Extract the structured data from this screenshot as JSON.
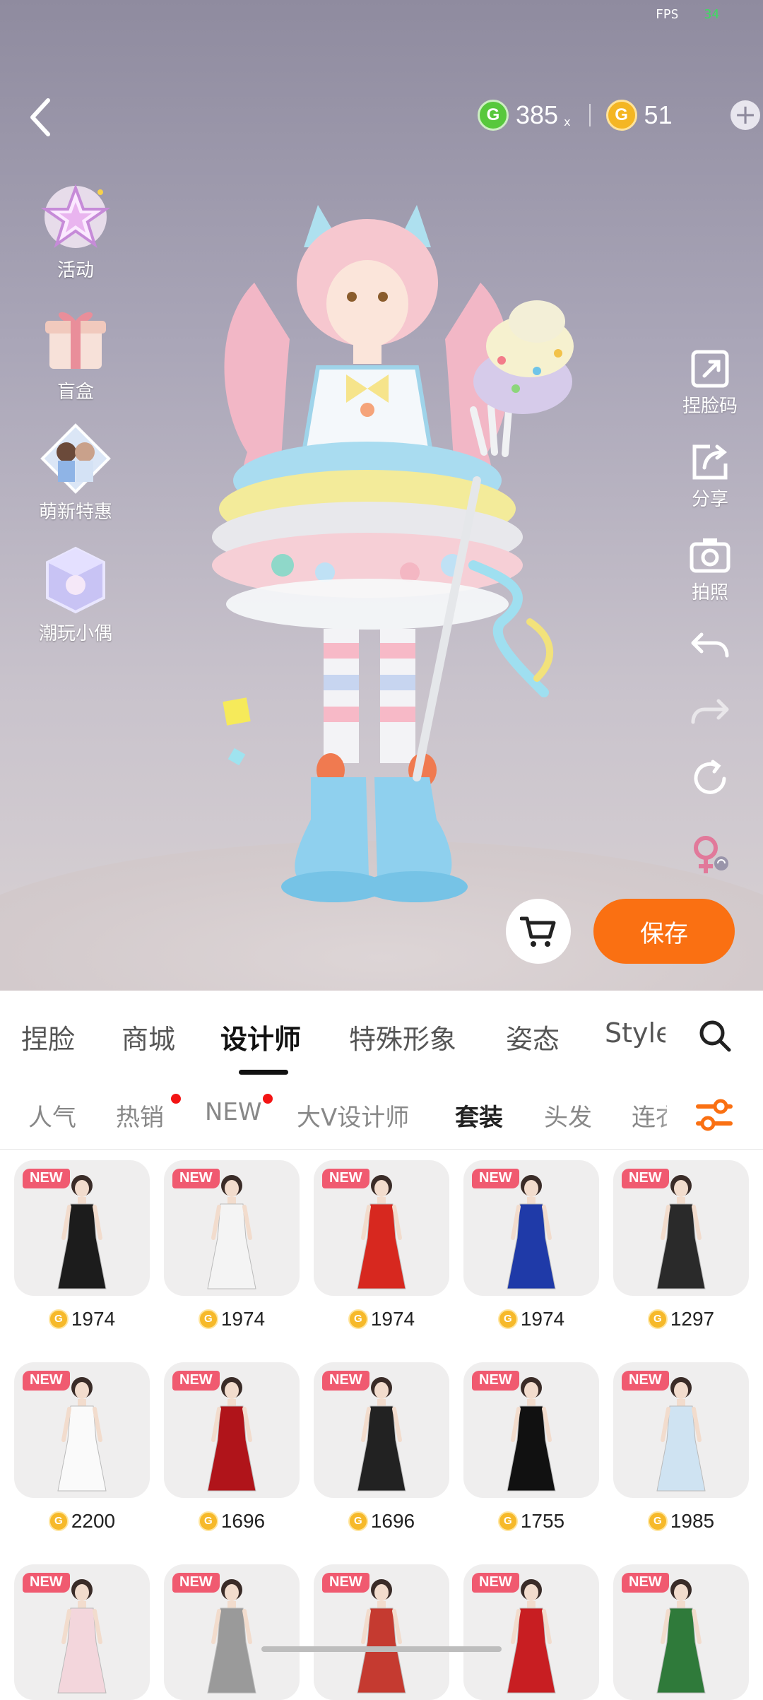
{
  "status": {
    "fps_label": "FPS",
    "fps_value": "34"
  },
  "currency": {
    "green_icon_letter": "G",
    "green_amount": "385",
    "green_suffix": "x",
    "gold_icon_letter": "G",
    "gold_amount": "51",
    "add_glyph": "+"
  },
  "left_menu": [
    {
      "label": "活动",
      "icon": "star-event-icon"
    },
    {
      "label": "盲盒",
      "icon": "gift-box-icon"
    },
    {
      "label": "萌新特惠",
      "icon": "newbie-deal-icon"
    },
    {
      "label": "潮玩小偶",
      "icon": "toy-figure-icon"
    }
  ],
  "right_tools": [
    {
      "label": "捏脸码",
      "icon": "face-code-icon"
    },
    {
      "label": "分享",
      "icon": "share-icon"
    },
    {
      "label": "拍照",
      "icon": "camera-icon"
    },
    {
      "label": "",
      "icon": "undo-icon"
    },
    {
      "label": "",
      "icon": "redo-icon"
    },
    {
      "label": "",
      "icon": "reset-icon"
    },
    {
      "label": "",
      "icon": "gender-switch-icon"
    }
  ],
  "actions": {
    "save_label": "保存"
  },
  "main_tabs": [
    {
      "label": "捏脸",
      "active": false
    },
    {
      "label": "商城",
      "active": false
    },
    {
      "label": "设计师",
      "active": true
    },
    {
      "label": "特殊形象",
      "active": false
    },
    {
      "label": "姿态",
      "active": false
    },
    {
      "label": "Style",
      "active": false
    }
  ],
  "sub_tabs": [
    {
      "label": "人气",
      "active": false,
      "dot": false
    },
    {
      "label": "热销",
      "active": false,
      "dot": true
    },
    {
      "label": "NEW",
      "active": false,
      "dot": true
    },
    {
      "label": "大V设计师",
      "active": false,
      "dot": false
    },
    {
      "label": "套装",
      "active": true,
      "dot": false
    },
    {
      "label": "头发",
      "active": false,
      "dot": false
    },
    {
      "label": "连衣",
      "active": false,
      "dot": false
    }
  ],
  "items": [
    {
      "badge": "NEW",
      "price": "1974",
      "color": "#1c1c1c"
    },
    {
      "badge": "NEW",
      "price": "1974",
      "color": "#f4f4f4"
    },
    {
      "badge": "NEW",
      "price": "1974",
      "color": "#d7281f"
    },
    {
      "badge": "NEW",
      "price": "1974",
      "color": "#1f3aa8"
    },
    {
      "badge": "NEW",
      "price": "1297",
      "color": "#2a2a2a"
    },
    {
      "badge": "NEW",
      "price": "2200",
      "color": "#fafafa"
    },
    {
      "badge": "NEW",
      "price": "1696",
      "color": "#b0141a"
    },
    {
      "badge": "NEW",
      "price": "1696",
      "color": "#222222"
    },
    {
      "badge": "NEW",
      "price": "1755",
      "color": "#111111"
    },
    {
      "badge": "NEW",
      "price": "1985",
      "color": "#cfe3f2"
    },
    {
      "badge": "NEW",
      "price": "",
      "color": "#f3d6dc"
    },
    {
      "badge": "NEW",
      "price": "",
      "color": "#9a9a9a"
    },
    {
      "badge": "NEW",
      "price": "",
      "color": "#c53a30"
    },
    {
      "badge": "NEW",
      "price": "",
      "color": "#c81e22"
    },
    {
      "badge": "NEW",
      "price": "",
      "color": "#2f7a3a"
    }
  ]
}
